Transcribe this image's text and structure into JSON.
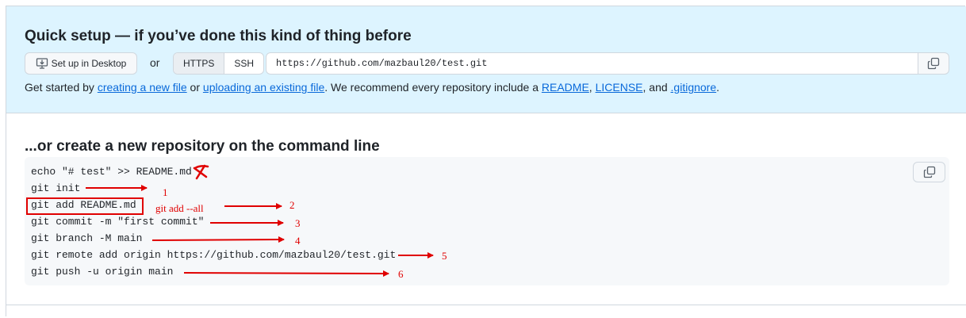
{
  "quick_setup": {
    "title": "Quick setup — if you’ve done this kind of thing before",
    "desktop_button": "Set up in Desktop",
    "or": "or",
    "protocols": [
      "HTTPS",
      "SSH"
    ],
    "selected_protocol": "HTTPS",
    "clone_url": "https://github.com/mazbaul20/test.git",
    "get_started": {
      "prefix": "Get started by ",
      "link1": "creating a new file",
      "mid1": " or ",
      "link2": "uploading an existing file",
      "mid2": ". We recommend every repository include a ",
      "link3": "README",
      "sep1": ", ",
      "link4": "LICENSE",
      "sep2": ", and ",
      "link5": ".gitignore",
      "suffix": "."
    }
  },
  "command_line": {
    "title": "...or create a new repository on the command line",
    "lines": [
      "echo \"# test\" >> README.md",
      "git init",
      "git add README.md",
      "git commit -m \"first commit\"",
      "git branch -M main",
      "git remote add origin https://github.com/mazbaul20/test.git",
      "git push -u origin main"
    ]
  },
  "annotations": {
    "note_git_add": "git add --all",
    "numbers": [
      "1",
      "2",
      "3",
      "4",
      "5",
      "6"
    ],
    "color": "#e00000"
  },
  "colors": {
    "banner_bg": "#ddf4ff",
    "link": "#0969da",
    "code_bg": "#f6f8fa"
  }
}
